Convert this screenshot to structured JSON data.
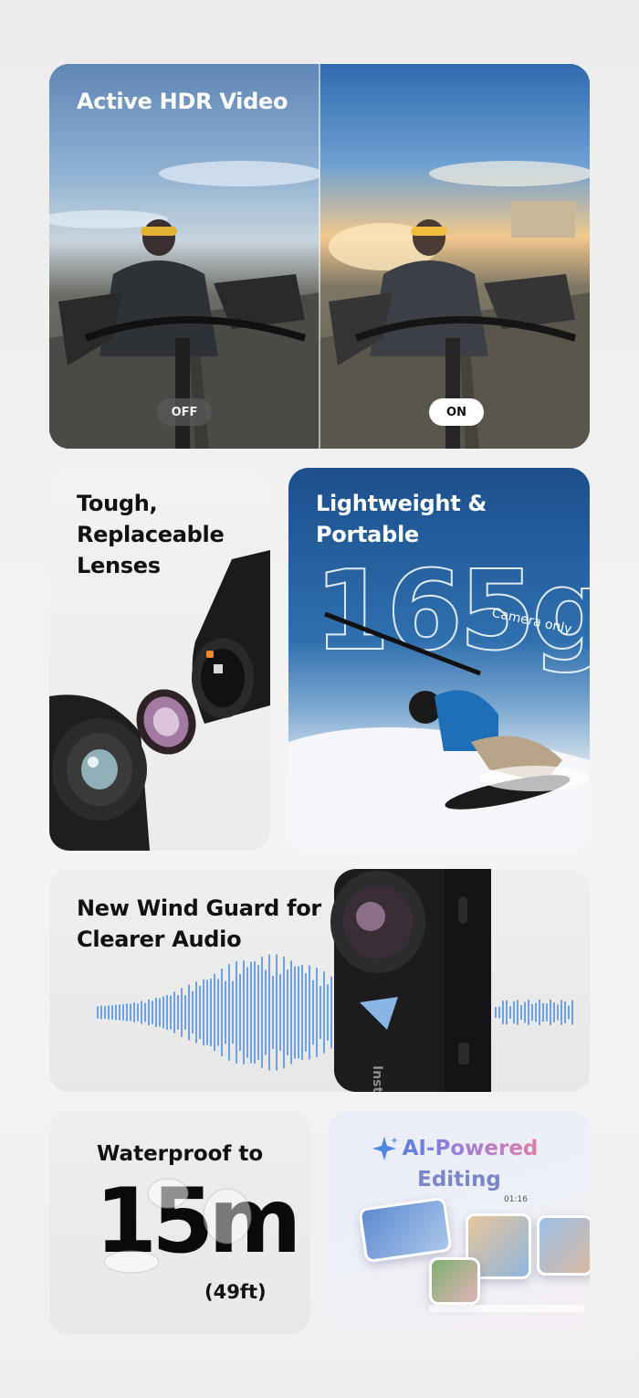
{
  "hdr": {
    "title": "Active HDR Video",
    "off_label": "OFF",
    "on_label": "ON"
  },
  "lenses": {
    "title": "Tough,\nReplaceable\nLenses"
  },
  "portable": {
    "title": "Lightweight &\nPortable",
    "weight": "165g",
    "weight_note": "Camera only"
  },
  "wind": {
    "title": "New Wind Guard for\nClearer Audio",
    "camera_brand_fragment": "Inst"
  },
  "waterproof": {
    "title": "Waterproof to",
    "depth": "15m",
    "depth_ft": "(49ft)"
  },
  "ai": {
    "title_line1": "AI-Powered",
    "title_line2": "Editing",
    "timestamp": "01:16"
  },
  "colors": {
    "ai_gradient_start": "#3e7fe6",
    "ai_gradient_end": "#e07ca6",
    "waveform_blue": "#4a90e2",
    "portable_sky": "#2f6fae"
  }
}
